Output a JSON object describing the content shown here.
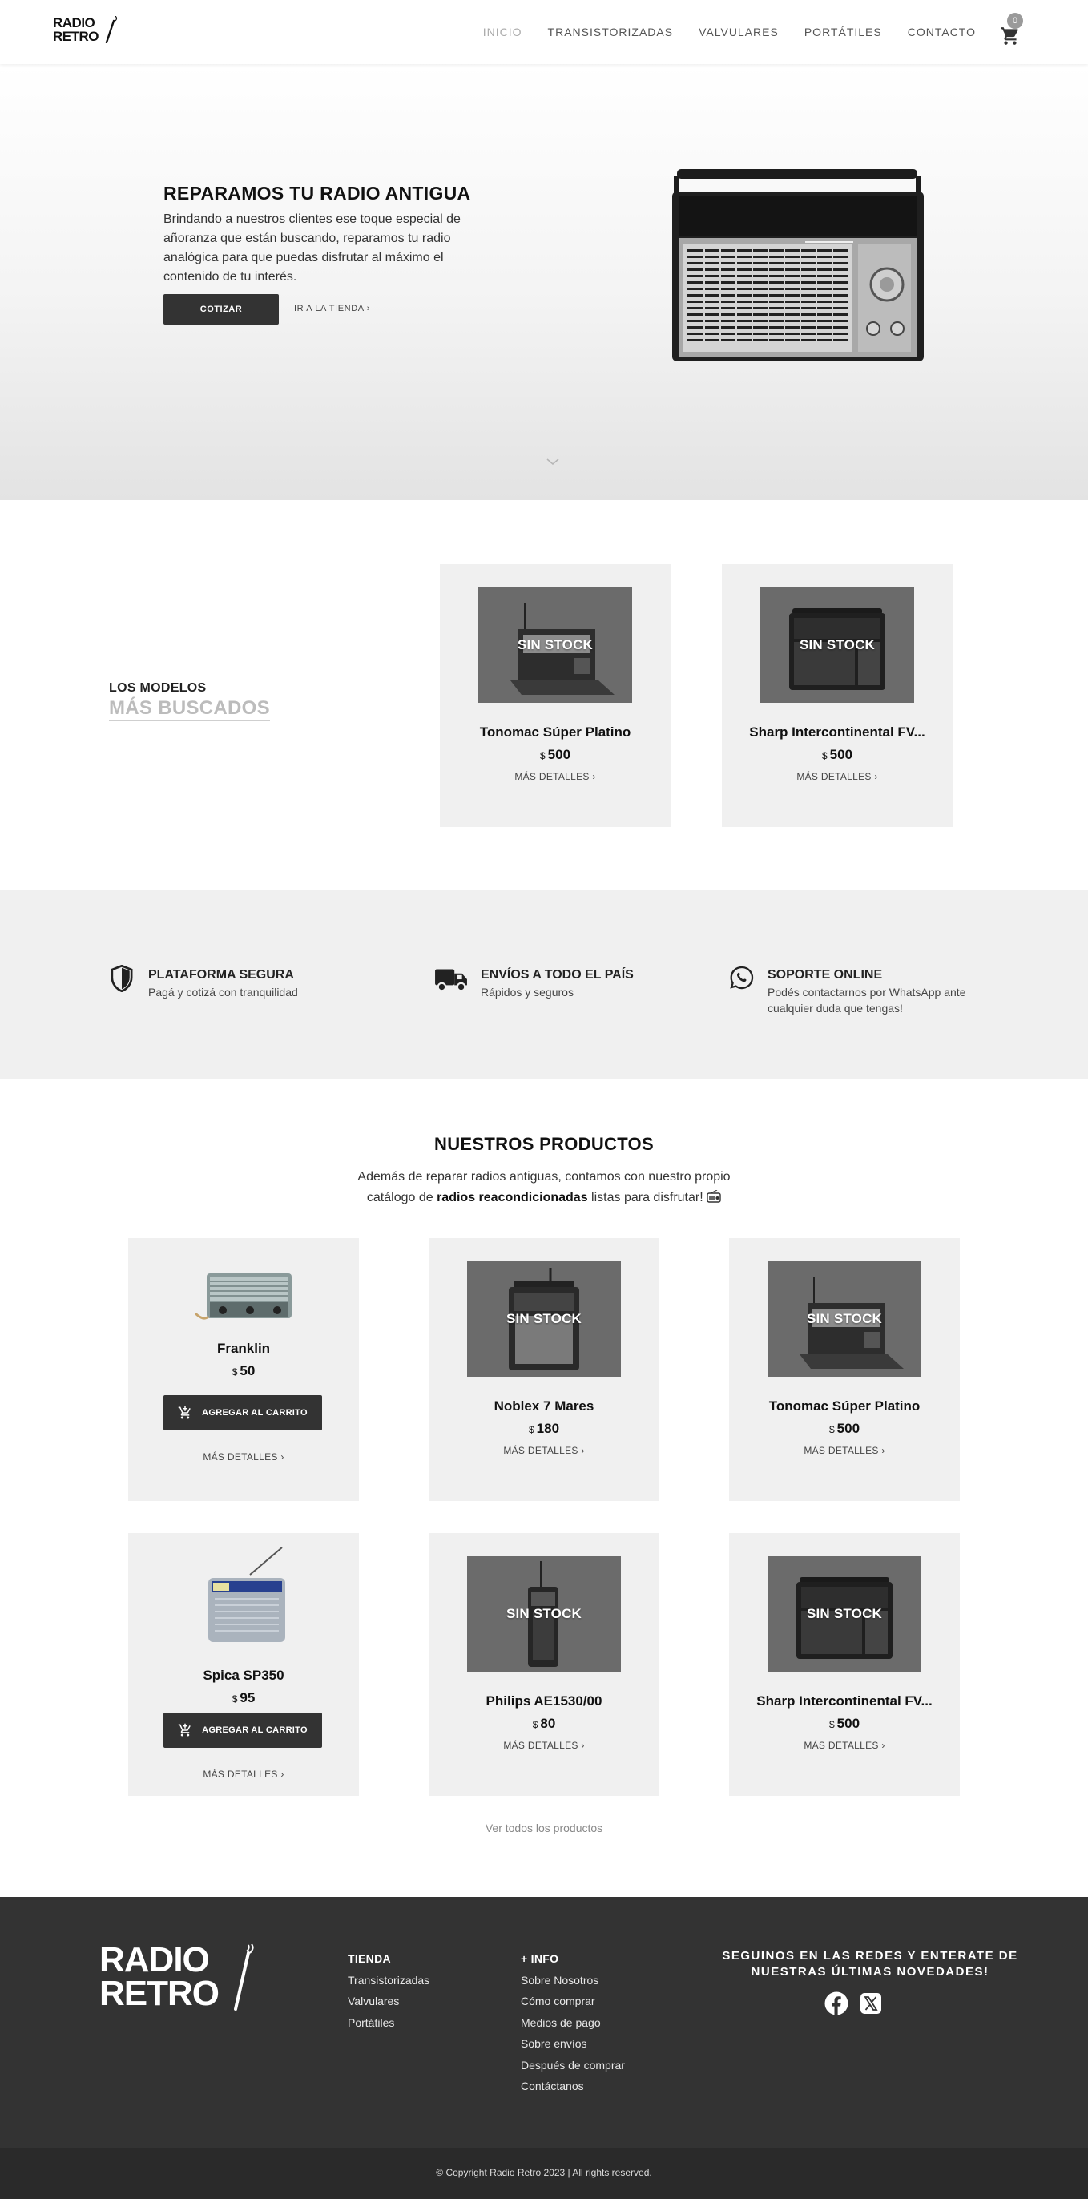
{
  "brand": {
    "logo_line1": "RADIO",
    "logo_line2": "RETRO"
  },
  "nav": {
    "items": [
      "INICIO",
      "TRANSISTORIZADAS",
      "VALVULARES",
      "PORTÁTILES",
      "CONTACTO"
    ],
    "active": "INICIO",
    "cart_count": "0"
  },
  "hero": {
    "title": "REPARAMOS TU RADIO ANTIGUA",
    "text": "Brindando a nuestros clientes ese toque especial de añoranza que están buscando, reparamos tu radio analógica para que puedas disfrutar al máximo el contenido de tu interés.",
    "primary_button": "COTIZAR",
    "secondary_link": "IR A LA TIENDA",
    "chevron": "›"
  },
  "most_searched": {
    "title_line1": "LOS MODELOS",
    "title_line2": "MÁS BUSCADOS",
    "products": [
      {
        "name": "Tonomac Súper Platino",
        "currency": "$",
        "price": "500",
        "badge": "SIN STOCK",
        "link": "MÁS DETALLES"
      },
      {
        "name": "Sharp Intercontinental FV...",
        "currency": "$",
        "price": "500",
        "badge": "SIN STOCK",
        "link": "MÁS DETALLES"
      }
    ]
  },
  "features": [
    {
      "icon": "shield-icon",
      "title": "PLATAFORMA SEGURA",
      "text": "Pagá y cotizá con tranquilidad"
    },
    {
      "icon": "truck-icon",
      "title": "ENVÍOS A TODO EL PAÍS",
      "text": "Rápidos y seguros"
    },
    {
      "icon": "whatsapp-icon",
      "title": "SOPORTE ONLINE",
      "text": "Podés contactarnos por WhatsApp ante cualquier duda que tengas!"
    }
  ],
  "products_section": {
    "title": "NUESTROS PRODUCTOS",
    "subtitle_pre": "Además de reparar radios antiguas, contamos con nuestro propio catálogo de",
    "subtitle_bold": "radios reacondicionadas",
    "subtitle_post": "listas para disfrutar!",
    "see_all": "Ver todos los productos",
    "add_to_cart": "AGREGAR AL CARRITO",
    "more": "MÁS DETALLES",
    "badge": "SIN STOCK",
    "items": [
      {
        "name": "Franklin",
        "currency": "$",
        "price": "50",
        "in_stock": true
      },
      {
        "name": "Noblex 7 Mares",
        "currency": "$",
        "price": "180",
        "in_stock": false
      },
      {
        "name": "Tonomac Súper Platino",
        "currency": "$",
        "price": "500",
        "in_stock": false
      },
      {
        "name": "Spica SP350",
        "currency": "$",
        "price": "95",
        "in_stock": true
      },
      {
        "name": "Philips AE1530/00",
        "currency": "$",
        "price": "80",
        "in_stock": false
      },
      {
        "name": "Sharp Intercontinental FV...",
        "currency": "$",
        "price": "500",
        "in_stock": false
      }
    ]
  },
  "footer": {
    "logo_line1": "RADIO",
    "logo_line2": "RETRO",
    "col1_title": "TIENDA",
    "col1_links": [
      "Transistorizadas",
      "Valvulares",
      "Portátiles"
    ],
    "col2_title": "+ INFO",
    "col2_links": [
      "Sobre Nosotros",
      "Cómo comprar",
      "Medios de pago",
      "Sobre envíos",
      "Después de comprar",
      "Contáctanos"
    ],
    "social_title": "SEGUINOS EN LAS REDES Y ENTERATE DE NUESTRAS ÚLTIMAS NOVEDADES!",
    "social_icons": [
      "facebook-icon",
      "x-twitter-icon"
    ],
    "copyright": "© Copyright Radio Retro 2023 | All rights reserved."
  }
}
